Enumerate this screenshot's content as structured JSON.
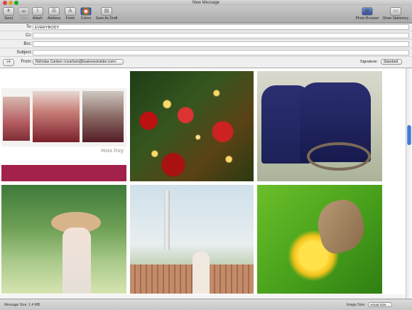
{
  "window": {
    "title": "New Message"
  },
  "toolbar": {
    "send": "Send",
    "chat": "Chat",
    "attach": "Attach",
    "address": "Address",
    "fonts": "Fonts",
    "colors": "Colors",
    "save_as_draft": "Save As Draft",
    "photo_browser": "Photo Browser",
    "show_stationery": "Show Stationery"
  },
  "header": {
    "to_label": "To:",
    "to_value": "EVERYBODY",
    "cc_label": "Cc:",
    "cc_value": "",
    "bcc_label": "Bcc:",
    "bcc_value": "",
    "subject_label": "Subject:",
    "subject_value": "",
    "from_label": "From:",
    "from_value": "Nicholas Carlson <ncarlson@businessinsider.com>",
    "signature_label": "Signature:",
    "signature_value": "Standard"
  },
  "photos": {
    "collage_caption": "miss  lray"
  },
  "status": {
    "message_size": "Message Size: 1.4 MB",
    "image_size_label": "Image Size:",
    "image_size_value": "Actual Size"
  },
  "colors": {
    "accent": "#2f6bcf",
    "collage_band": "#a3224a"
  }
}
